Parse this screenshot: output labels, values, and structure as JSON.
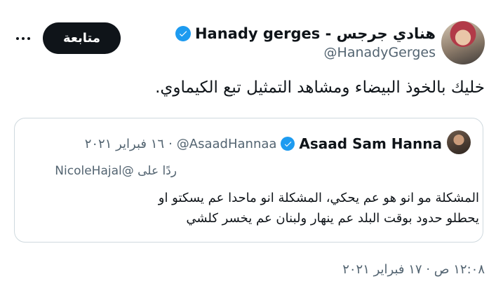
{
  "author": {
    "display_name": "Hanady gerges - هنادي جرجس",
    "handle": "@HanadyGerges",
    "verified": true
  },
  "actions": {
    "follow_label": "متابعة",
    "more_label": "..."
  },
  "tweet": {
    "text": "خليك بالخوذ البيضاء ومشاهد التمثيل تبع الكيماوي.",
    "timestamp": "١٢:٠٨ ص · ١٧ فبراير ٢٠٢١"
  },
  "quoted": {
    "display_name": "Asaad Sam Hanna",
    "handle": "@AsaadHannaa",
    "separator": "·",
    "date": "١٦ فبراير ٢٠٢١",
    "reply_to_prefix": "ردًا على",
    "reply_to_handle": "@NicoleHajal",
    "text_line1": "المشكلة مو انو هو عم يحكي، المشكلة انو ماحدا عم يسكتو او",
    "text_line2": "يحطلو حدود بوقت البلد عم ينهار ولبنان عم يخسر كلشي",
    "verified": true
  },
  "colors": {
    "verified_blue": "#1d9bf0",
    "secondary_text": "#536471",
    "primary_text": "#0f1419",
    "border": "#cfd9de"
  },
  "icons": {
    "verified": "verified-badge-icon",
    "more": "more-horizontal-icon"
  }
}
